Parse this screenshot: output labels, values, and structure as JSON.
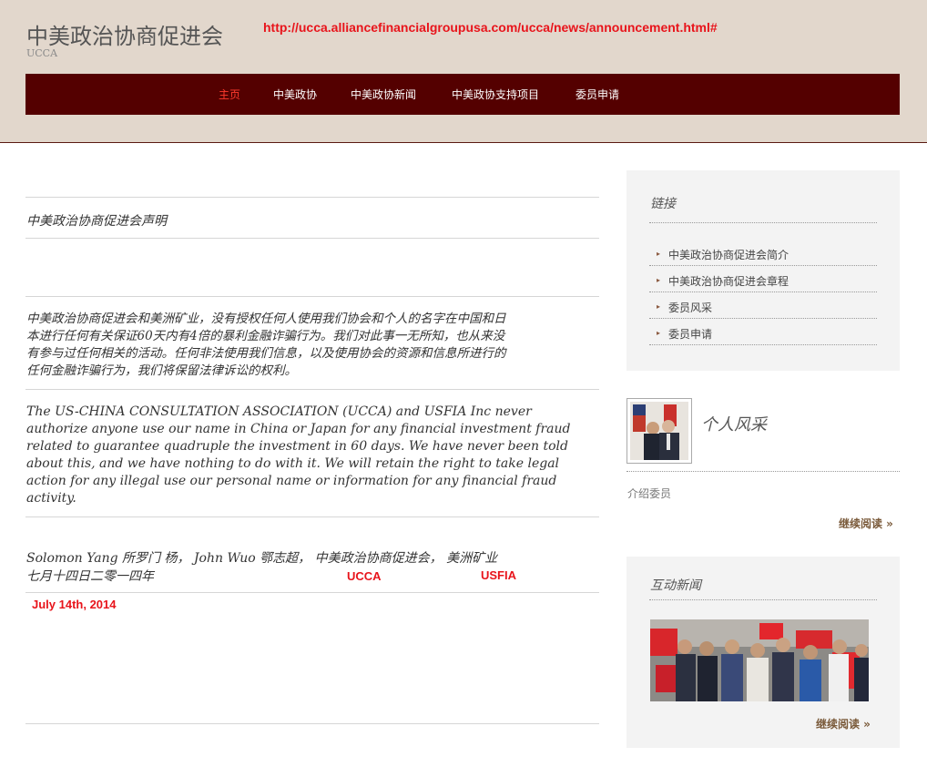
{
  "site": {
    "title": "中美政治协商促进会",
    "subtitle": "UCCA",
    "url_annotation": "http://ucca.alliancefinancialgroupusa.com/ucca/news/announcement.html#"
  },
  "nav": {
    "items": [
      {
        "label": "主页",
        "active": true
      },
      {
        "label": "中美政协"
      },
      {
        "label": "中美政协新闻"
      },
      {
        "label": "中美政协支持项目"
      },
      {
        "label": "委员申请"
      }
    ]
  },
  "article": {
    "heading": "中美政治协商促进会声明",
    "chinese_lines": [
      "中美政治协商促进会和美洲矿业，没有授权任何人使用我们协会和个人的名字在中国和日",
      "本进行任何有关保证60天内有4倍的暴利金融诈骗行为。我们对此事一无所知，也从来没",
      "有参与过任何相关的活动。任何非法使用我们信息，以及使用协会的资源和信息所进行的",
      "任何金融诈骗行为，我们将保留法律诉讼的权利。"
    ],
    "english_lines": [
      "The US-CHINA CONSULTATION ASSOCIATION (UCCA) and USFIA Inc never",
      "authorize anyone use our name in China or Japan for any financial investment fraud",
      "related to guarantee quadruple the investment in 60 days. We have never been told",
      "about this, and we have nothing to do with it. We will retain the right to take legal",
      "action for any illegal use our personal name or information for any financial fraud",
      "activity."
    ],
    "signature_line": "Solomon Yang 所罗门 杨， John Wuo 鄂志超， 中美政治协商促进会， 美洲矿业",
    "date_cn": "七月十四日二零一四年",
    "annot_ucca": "UCCA",
    "annot_usfia": "USFIA",
    "date_en": "July 14th, 2014"
  },
  "sidebar": {
    "links_title": "链接",
    "links": [
      "中美政治协商促进会简介",
      "中美政治协商促进会章程",
      "委员风采",
      "委员申请"
    ],
    "profile": {
      "title": "个人风采",
      "desc": "介绍委员",
      "more": "继续阅读 »"
    },
    "news": {
      "title": "互动新闻",
      "more": "继续阅读 »"
    }
  },
  "colors": {
    "nav_bg": "#540000",
    "header_bg": "#e2d7cc",
    "accent_red": "#e8141b"
  }
}
